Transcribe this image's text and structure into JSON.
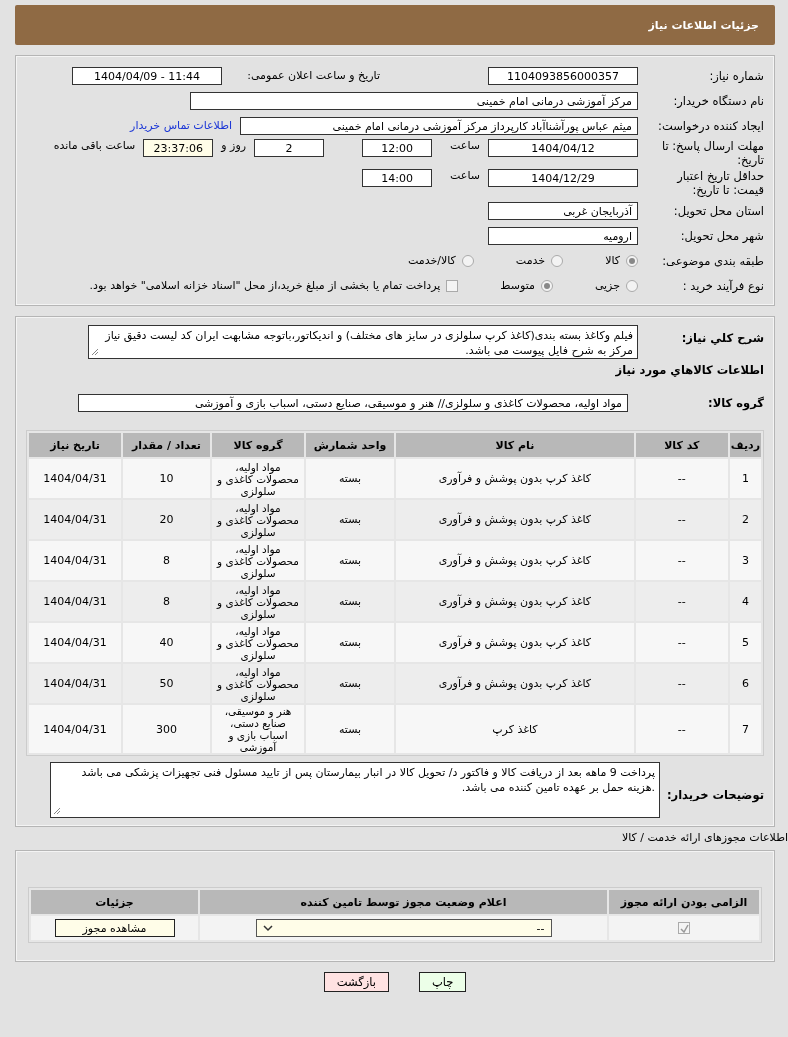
{
  "header": {
    "title": "جزئیات اطلاعات نیاز"
  },
  "need_info": {
    "need_number_label": "شماره نیاز:",
    "need_number": "1104093856000357",
    "announce_label": "تاریخ و ساعت اعلان عمومی:",
    "announce_datetime": "1404/04/09 - 11:44",
    "buyer_org_label": "نام دستگاه خریدار:",
    "buyer_org": "مرکز آموزشی درمانی امام خمینی",
    "requester_label": "ایجاد کننده درخواست:",
    "requester": "میثم عباس پورآشناآباد کارپرداز مرکز آموزشی درمانی امام خمینی",
    "contact_link": "اطلاعات تماس خریدار",
    "deadline_label": "مهلت ارسال پاسخ: تا تاریخ:",
    "deadline_date": "1404/04/12",
    "deadline_time_label": "ساعت",
    "deadline_time": "12:00",
    "days": "2",
    "days_label": "روز و",
    "remaining": "23:37:06",
    "remaining_label": "ساعت باقی مانده",
    "validity_label": "حداقل تاریخ اعتبار قیمت: تا تاریخ:",
    "validity_date": "1404/12/29",
    "validity_time_label": "ساعت",
    "validity_time": "14:00",
    "province_label": "استان محل تحویل:",
    "province": "آذربایجان غربی",
    "city_label": "شهر محل تحویل:",
    "city": "ارومیه",
    "category_label": "طبقه بندی موضوعی:",
    "category_options": [
      {
        "label": "کالا",
        "selected": true
      },
      {
        "label": "خدمت",
        "selected": false
      },
      {
        "label": "کالا/خدمت",
        "selected": false
      }
    ],
    "process_label": "نوع فرآیند خرید :",
    "process_options": [
      {
        "label": "جزیی",
        "selected": false
      },
      {
        "label": "متوسط",
        "selected": true
      }
    ],
    "payment_option": {
      "label": "پرداخت تمام یا بخشی از مبلغ خرید،از محل \"اسناد خزانه اسلامی\" خواهد بود.",
      "checked": false
    }
  },
  "goods": {
    "description_label": "شرح کلي نیاز:",
    "description": "فیلم وکاغذ بسته بندی(کاغذ کرپ سلولزی در سایز های مختلف) و اندیکاتور،باتوجه مشابهت ایران کد لیست دقیق نیاز مرکز به شرح فایل پیوست می باشد.",
    "section_title": "اطلاعات کالاهاي مورد نیاز",
    "group_label": "گروه کالا:",
    "group": "مواد اولیه، محصولات کاغذی و سلولزی// هنر و موسیقی، صنایع دستی، اسباب بازی و آموزشی",
    "table": {
      "columns": [
        "ردیف",
        "کد کالا",
        "نام کالا",
        "واحد شمارش",
        "گروه کالا",
        "تعداد / مقدار",
        "تاریخ نیاز"
      ],
      "rows": [
        {
          "row": "1",
          "code": "--",
          "name": "کاغذ کرپ بدون پوشش و فرآوری",
          "unit": "بسته",
          "group": "مواد اولیه، محصولات کاغذی و سلولزی",
          "quantity": "10",
          "date": "1404/04/31"
        },
        {
          "row": "2",
          "code": "--",
          "name": "کاغذ کرپ بدون پوشش و فرآوری",
          "unit": "بسته",
          "group": "مواد اولیه، محصولات کاغذی و سلولزی",
          "quantity": "20",
          "date": "1404/04/31"
        },
        {
          "row": "3",
          "code": "--",
          "name": "کاغذ کرپ بدون پوشش و فرآوری",
          "unit": "بسته",
          "group": "مواد اولیه، محصولات کاغذی و سلولزی",
          "quantity": "8",
          "date": "1404/04/31"
        },
        {
          "row": "4",
          "code": "--",
          "name": "کاغذ کرپ بدون پوشش و فرآوری",
          "unit": "بسته",
          "group": "مواد اولیه، محصولات کاغذی و سلولزی",
          "quantity": "8",
          "date": "1404/04/31"
        },
        {
          "row": "5",
          "code": "--",
          "name": "کاغذ کرپ بدون پوشش و فرآوری",
          "unit": "بسته",
          "group": "مواد اولیه، محصولات کاغذی و سلولزی",
          "quantity": "40",
          "date": "1404/04/31"
        },
        {
          "row": "6",
          "code": "--",
          "name": "کاغذ کرپ بدون پوشش و فرآوری",
          "unit": "بسته",
          "group": "مواد اولیه، محصولات کاغذی و سلولزی",
          "quantity": "50",
          "date": "1404/04/31"
        },
        {
          "row": "7",
          "code": "--",
          "name": "کاغذ کرپ",
          "unit": "بسته",
          "group": "هنر و موسیقی، صنایع دستی، اسباب بازی و آموزشی",
          "quantity": "300",
          "date": "1404/04/31"
        }
      ]
    },
    "notes_label": "توضیحات خریدار:",
    "notes": "پرداخت  9  ماهه بعد از دریافت کالا و فاکتور د/ تحویل کالا در انبار بیمارستان پس از تایید مسئول فنی تجهیزات پزشکی می باشد .هزینه حمل بر عهده تامین کننده می باشد."
  },
  "licenses": {
    "title": "اطلاعات مجوزهای ارائه خدمت / کالا",
    "columns": [
      "الزامی بودن ارائه مجوز",
      "اعلام وضعیت مجوز توسط تامین کننده",
      "جزئیات"
    ],
    "rows": [
      {
        "required": true,
        "status": "--",
        "details_button": "مشاهده مجوز"
      }
    ]
  },
  "buttons": [
    {
      "label": "چاپ",
      "kind": "print"
    },
    {
      "label": "بازگشت",
      "kind": "back"
    }
  ]
}
